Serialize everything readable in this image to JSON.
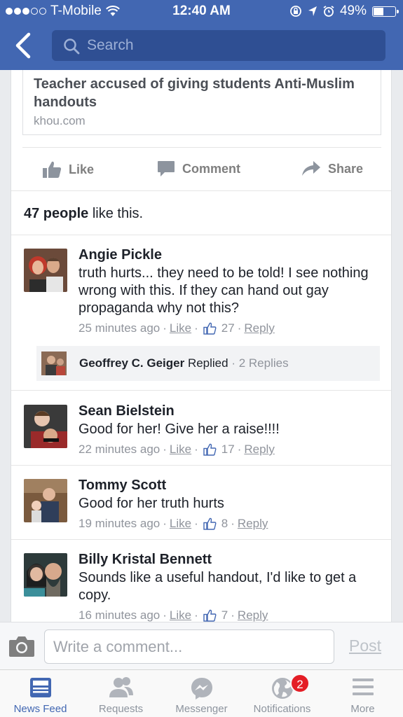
{
  "status_bar": {
    "carrier": "T-Mobile",
    "time": "12:40 AM",
    "battery": "49%",
    "battery_level": 0.49
  },
  "header": {
    "search_placeholder": "Search"
  },
  "post": {
    "link_title": "Teacher accused of giving students Anti-Muslim handouts",
    "link_domain": "khou.com",
    "actions": {
      "like": "Like",
      "comment": "Comment",
      "share": "Share"
    },
    "likes_count": "47 people",
    "likes_suffix": " like this."
  },
  "comments": [
    {
      "name": "Angie Pickle",
      "text": "truth hurts... they need to be told!  I see nothing wrong with this.  If they can  hand out gay propaganda why not this?",
      "time": "25 minutes ago",
      "like": "Like",
      "likes": "27",
      "reply": "Reply"
    },
    {
      "name": "Sean Bielstein",
      "text": "Good for her! Give her a raise!!!!",
      "time": "22 minutes ago",
      "like": "Like",
      "likes": "17",
      "reply": "Reply"
    },
    {
      "name": "Tommy Scott",
      "text": "Good for her truth hurts",
      "time": "19 minutes ago",
      "like": "Like",
      "likes": "8",
      "reply": "Reply"
    },
    {
      "name": "Billy Kristal Bennett",
      "text": "Sounds like a useful handout, I'd like to get a copy.",
      "time": "16 minutes ago",
      "like": "Like",
      "likes": "7",
      "reply": "Reply"
    }
  ],
  "reply_thread": {
    "name": "Geoffrey C. Geiger",
    "action": " Replied",
    "count": "2 Replies"
  },
  "composer": {
    "placeholder": "Write a comment...",
    "post": "Post"
  },
  "tabs": [
    {
      "label": "News Feed",
      "icon": "news-feed-icon",
      "active": true
    },
    {
      "label": "Requests",
      "icon": "friends-icon"
    },
    {
      "label": "Messenger",
      "icon": "messenger-icon"
    },
    {
      "label": "Notifications",
      "icon": "globe-icon",
      "badge": "2"
    },
    {
      "label": "More",
      "icon": "menu-icon"
    }
  ],
  "colors": {
    "brand": "#4267b2",
    "badge": "#e41e26"
  }
}
